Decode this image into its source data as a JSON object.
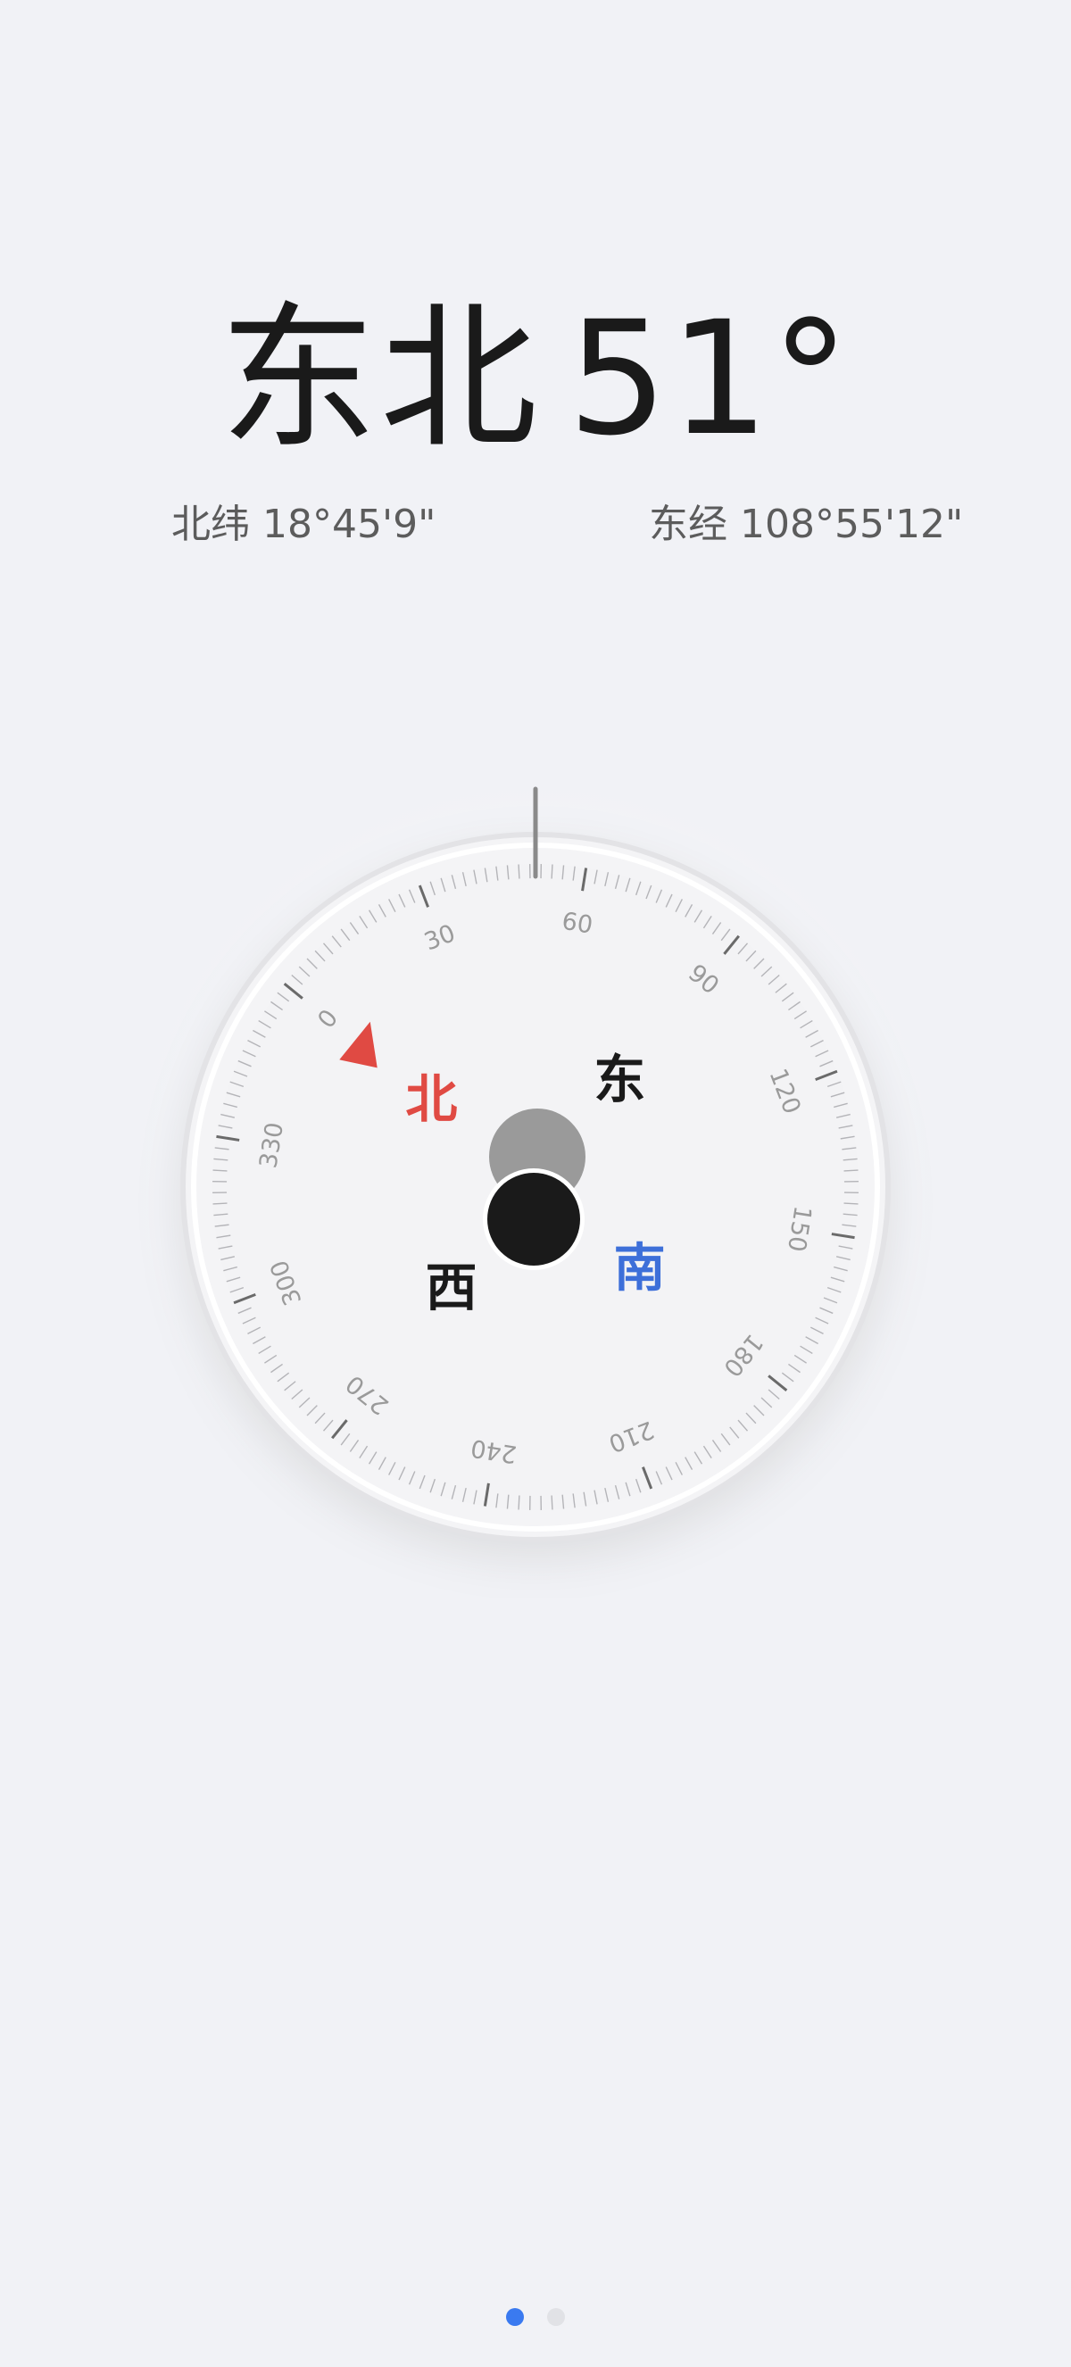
{
  "heading": {
    "direction": "东北",
    "degrees": "51°"
  },
  "location": {
    "latitude_label": "北纬",
    "latitude_value": "18°45'9\"",
    "longitude_label": "东经",
    "longitude_value": "108°55'12\""
  },
  "compass": {
    "heading_deg": 51,
    "cardinals": {
      "north": "北",
      "east": "东",
      "south": "南",
      "west": "西"
    },
    "degree_labels": [
      "0",
      "30",
      "60",
      "90",
      "120",
      "150",
      "180",
      "210",
      "240",
      "270",
      "300",
      "330"
    ],
    "colors": {
      "north": "#e04a43",
      "south": "#3d6fd9",
      "text": "#1a1a1a",
      "tick": "#9a9a9a",
      "needle": "#8a8a8a"
    }
  },
  "pagination": {
    "pages": 2,
    "current": 1,
    "active_color": "#3a7af0"
  }
}
